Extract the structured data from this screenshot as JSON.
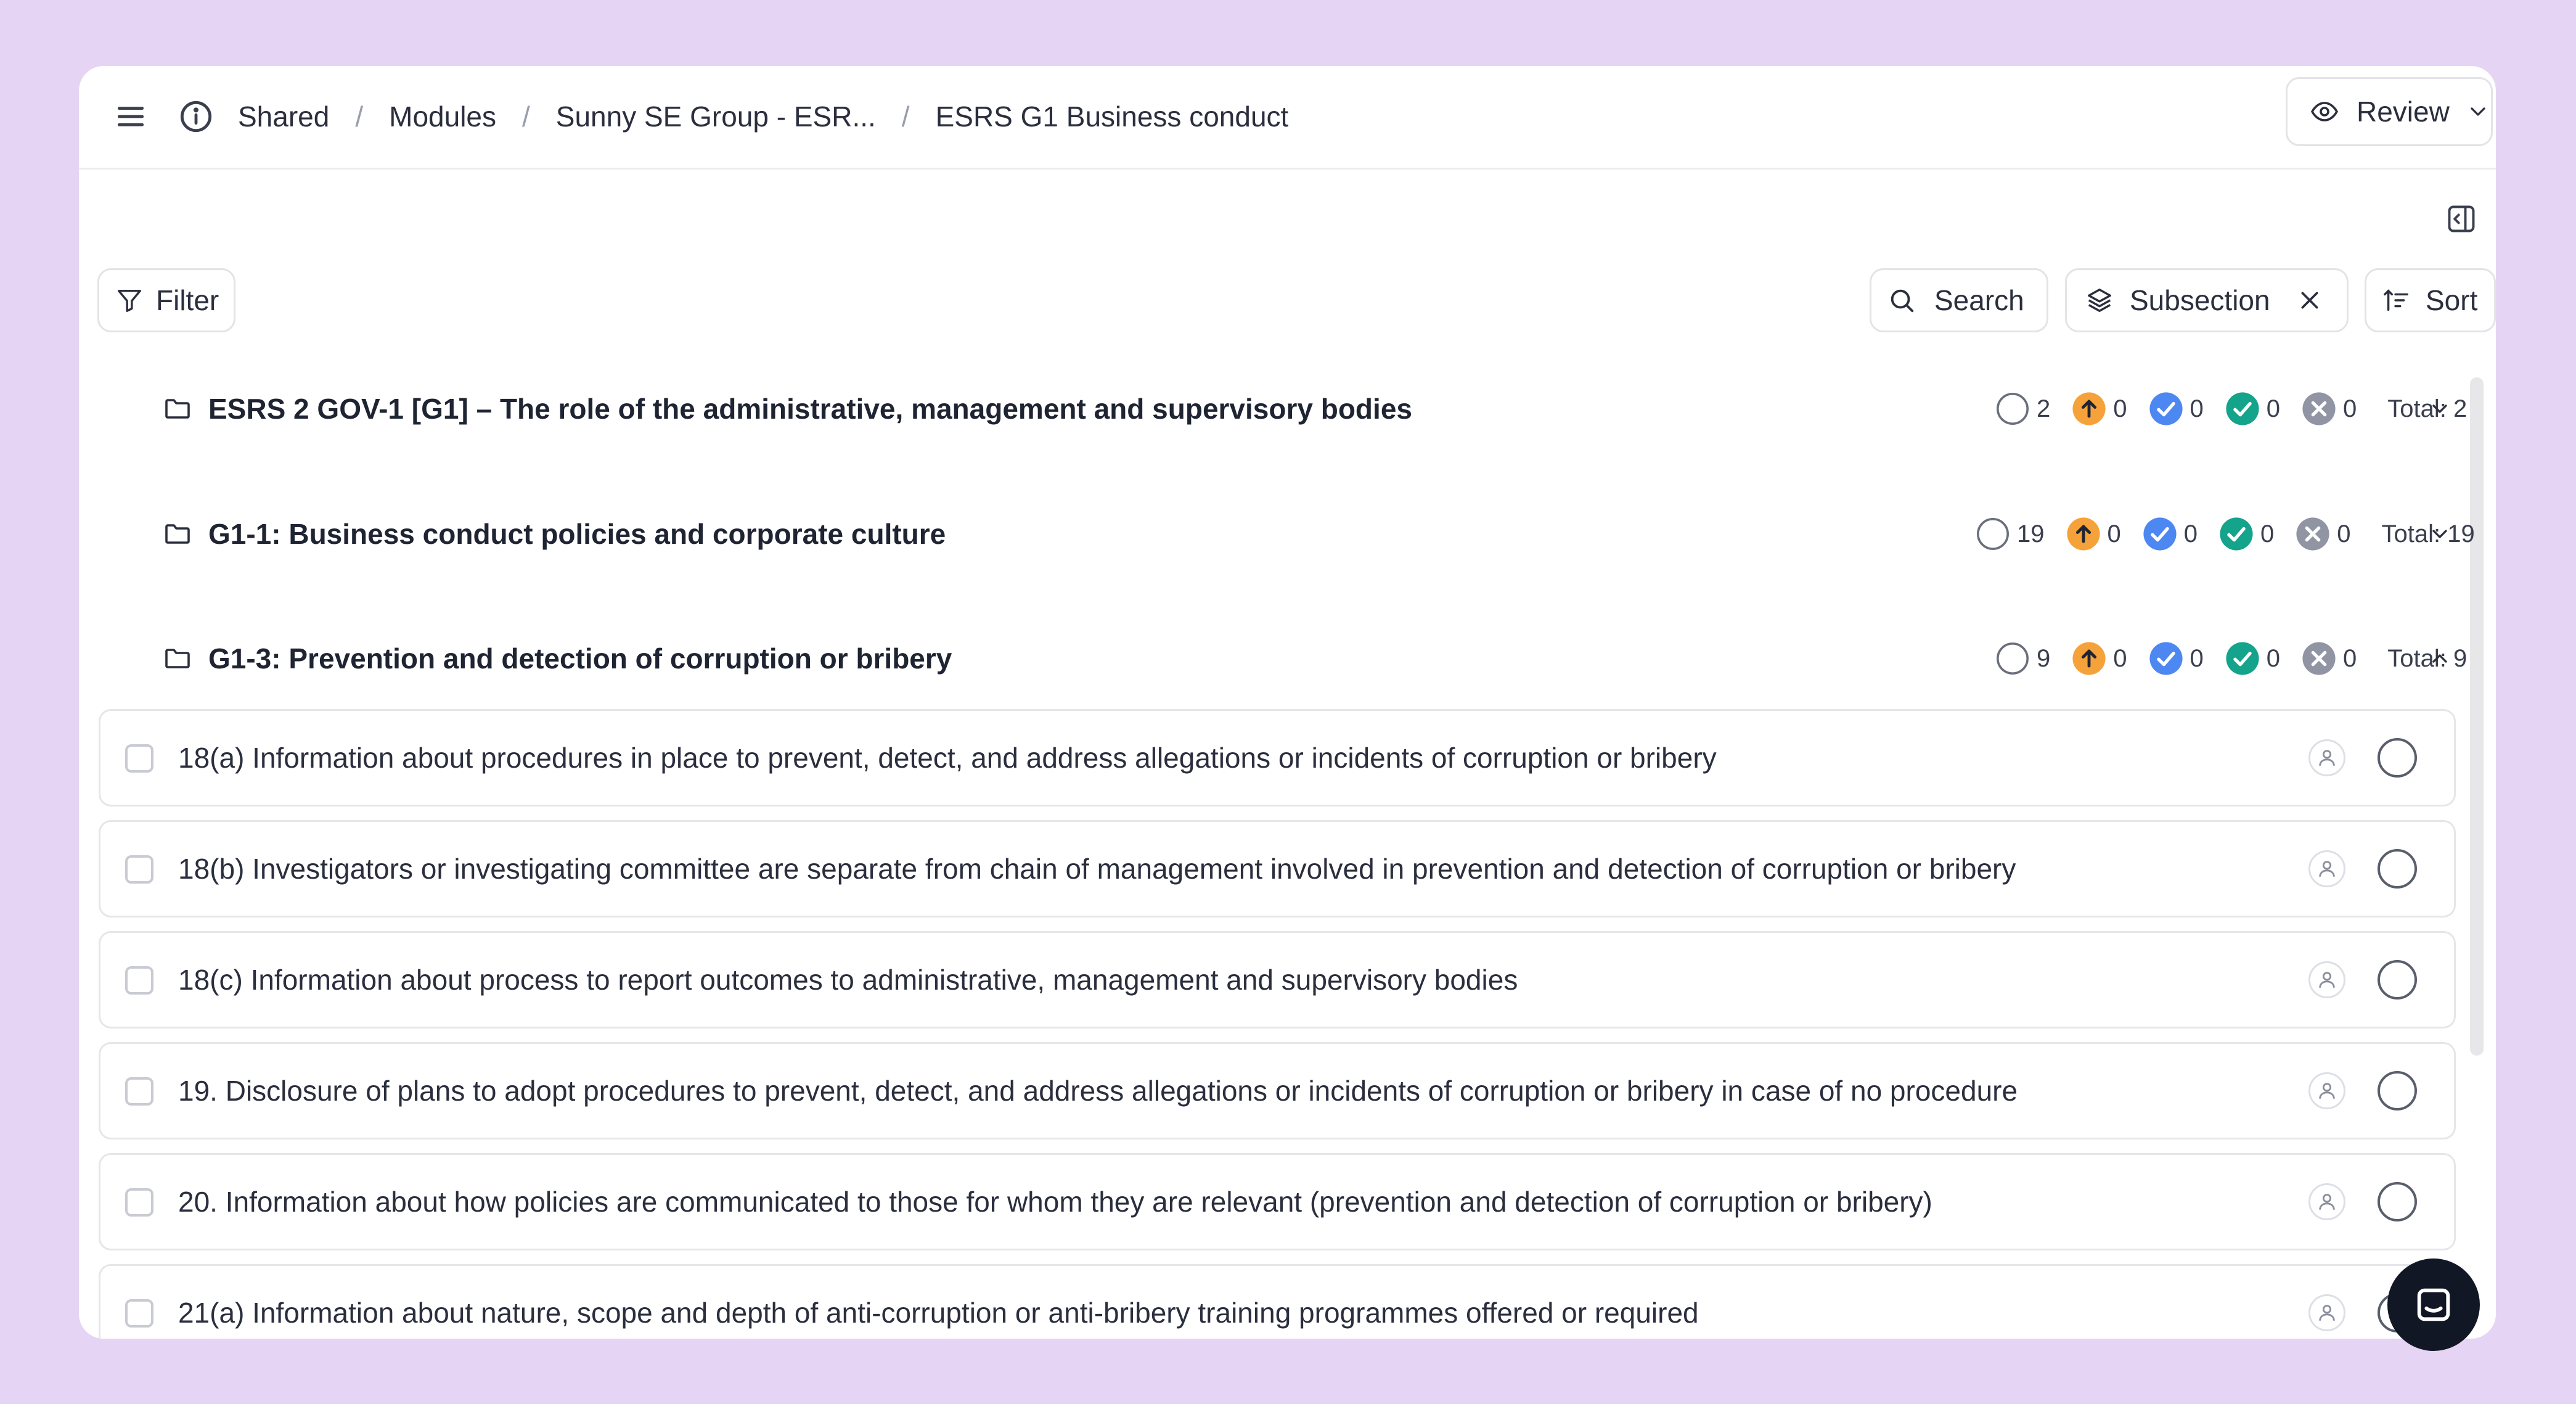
{
  "breadcrumb": [
    "Shared",
    "Modules",
    "Sunny SE Group - ESR...",
    "ESRS G1 Business conduct"
  ],
  "breadcrumb_separator": "/",
  "review_button": {
    "label": "Review",
    "icon": "eye-icon"
  },
  "toolbar": {
    "filter_label": "Filter",
    "search_label": "Search",
    "subsection_label": "Subsection",
    "sort_label": "Sort"
  },
  "status_colors": {
    "open": "#ffffff",
    "in_progress": "#f6a23a",
    "review": "#4d87f2",
    "done": "#14a38b",
    "rejected": "#9094a3"
  },
  "sections": [
    {
      "title": "ESRS 2 GOV-1 [G1] – The role of the administrative, management and supervisory bodies",
      "counts": {
        "open": "2",
        "in_progress": "0",
        "review": "0",
        "done": "0",
        "rejected": "0"
      },
      "total": "Total: 2",
      "expanded": false
    },
    {
      "title": "G1-1: Business conduct policies and corporate culture",
      "counts": {
        "open": "19",
        "in_progress": "0",
        "review": "0",
        "done": "0",
        "rejected": "0"
      },
      "total": "Total: 19",
      "expanded": false
    },
    {
      "title": "G1-3: Prevention and detection of corruption or bribery",
      "counts": {
        "open": "9",
        "in_progress": "0",
        "review": "0",
        "done": "0",
        "rejected": "0"
      },
      "total": "Total: 9",
      "expanded": true
    }
  ],
  "items": [
    "18(a) Information about procedures in place to prevent, detect, and address allegations or incidents of corruption or bribery",
    "18(b) Investigators or investigating committee are separate from chain of management involved in prevention and detection of corruption or bribery",
    "18(c) Information about process to report outcomes to administrative, management and supervisory bodies",
    "19. Disclosure of plans to adopt procedures to prevent, detect, and address allegations or incidents of corruption or bribery in case of no procedure",
    "20. Information about how policies are communicated to those for whom they are relevant (prevention and detection of corruption or bribery)",
    "21(a) Information about nature, scope and depth of anti-corruption or anti-bribery training programmes offered or required"
  ]
}
